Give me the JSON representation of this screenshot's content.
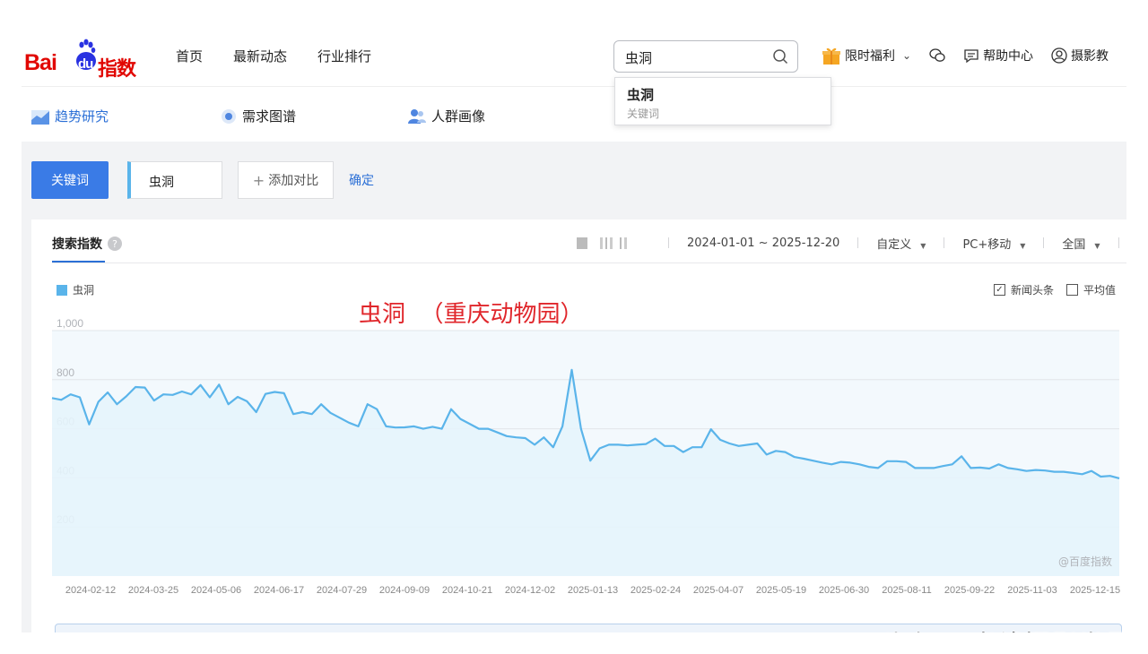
{
  "logo": {
    "text_left": "Bai",
    "text_mid": "du",
    "text_right": "指数"
  },
  "nav": {
    "links": [
      "首页",
      "最新动态",
      "行业排行"
    ]
  },
  "search": {
    "value": "虫洞",
    "suggestion_title": "虫洞",
    "suggestion_sub": "关键词"
  },
  "right_nav": {
    "welfare": "限时福利",
    "help": "帮助中心",
    "user": "摄影教"
  },
  "subtabs": [
    "趋势研究",
    "需求图谱",
    "人群画像"
  ],
  "keyword_row": {
    "kw_button": "关键词",
    "kw_value": "虫洞",
    "add_compare": "添加对比",
    "confirm": "确定"
  },
  "card": {
    "title": "搜索指数",
    "date_range": "2024-01-01 ~ 2025-12-20",
    "custom": "自定义",
    "device": "PC+移动",
    "region": "全国",
    "news_label": "新闻头条",
    "avg_label": "平均值",
    "annotation": "虫洞  （重庆动物园）",
    "copyright": "@百度指数"
  },
  "watermark": "头条 @光线摄影世界",
  "chart_data": {
    "type": "area",
    "series": [
      {
        "name": "虫洞",
        "color": "#5ab4ea"
      }
    ],
    "ylim": [
      0,
      1000
    ],
    "yticks": [
      200,
      400,
      600,
      800,
      "1,000"
    ],
    "xticks": [
      "2024-02-12",
      "2024-03-25",
      "2024-05-06",
      "2024-06-17",
      "2024-07-29",
      "2024-09-09",
      "2024-10-21",
      "2024-12-02",
      "2025-01-13",
      "2025-02-24",
      "2025-04-07",
      "2025-05-19",
      "2025-06-30",
      "2025-08-11",
      "2025-09-22",
      "2025-11-03",
      "2025-12-15"
    ],
    "values": [
      725,
      718,
      740,
      728,
      618,
      710,
      748,
      700,
      732,
      770,
      768,
      715,
      740,
      738,
      752,
      740,
      778,
      728,
      780,
      700,
      730,
      712,
      668,
      742,
      750,
      745,
      660,
      668,
      660,
      700,
      665,
      645,
      625,
      610,
      700,
      680,
      610,
      605,
      606,
      610,
      600,
      608,
      600,
      680,
      640,
      620,
      600,
      600,
      585,
      570,
      565,
      562,
      535,
      565,
      525,
      610,
      840,
      600,
      470,
      520,
      535,
      535,
      532,
      535,
      538,
      560,
      530,
      530,
      505,
      525,
      525,
      598,
      555,
      540,
      530,
      535,
      540,
      495,
      510,
      505,
      485,
      478,
      470,
      462,
      455,
      465,
      462,
      455,
      445,
      440,
      468,
      468,
      465,
      440,
      440,
      440,
      448,
      455,
      488,
      440,
      442,
      438,
      455,
      440,
      435,
      428,
      432,
      430,
      425,
      425,
      420,
      415,
      428,
      405,
      408,
      398
    ]
  }
}
